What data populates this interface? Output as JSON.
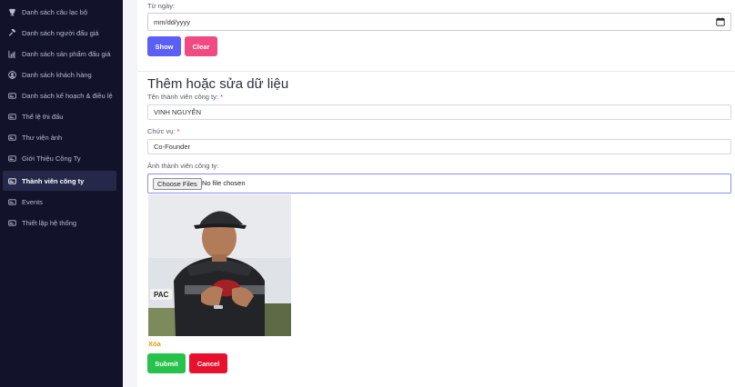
{
  "sidebar": {
    "items": [
      {
        "label": "Danh sách câu lạc bộ",
        "icon": "trophy-icon"
      },
      {
        "label": "Danh sách người đấu giá",
        "icon": "gavel-icon"
      },
      {
        "label": "Danh sách sản phẩm đấu giá",
        "icon": "chart-icon"
      },
      {
        "label": "Danh sách khách hàng",
        "icon": "user-icon"
      },
      {
        "label": "Danh sách kế hoạch & điều lệ",
        "icon": "card-icon"
      },
      {
        "label": "Thể lệ thi đấu",
        "icon": "card-icon"
      },
      {
        "label": "Thư viện ảnh",
        "icon": "card-icon"
      },
      {
        "label": "Giới Thiệu Công Ty",
        "icon": "card-icon"
      },
      {
        "label": "Thành viên công ty",
        "icon": "card-icon",
        "active": true
      },
      {
        "label": "Events",
        "icon": "card-icon"
      },
      {
        "label": "Thiết lập hệ thống",
        "icon": "card-icon"
      }
    ]
  },
  "filter": {
    "from_label": "Từ ngày:",
    "from_placeholder": "mm/dd/yyyy",
    "show_label": "Show",
    "clear_label": "Clear"
  },
  "form": {
    "title": "Thêm hoặc sửa dữ liệu",
    "name_label": "Tên thành viên công ty:",
    "name_value": "VINH NGUYỄN",
    "position_label": "Chức vụ:",
    "position_value": "Co-Founder",
    "photo_label": "Ảnh thành viên công ty:",
    "choose_files_label": "Choose Files",
    "file_status": "No file chosen",
    "delete_label": "Xóa",
    "submit_label": "Submit",
    "cancel_label": "Cancel",
    "required_mark": "*"
  },
  "colors": {
    "sidebar_bg": "#12132b",
    "show_button": "#5b5ff5",
    "clear_button": "#ef4a82",
    "submit_button": "#27c24c",
    "cancel_button": "#e8112d",
    "delete_link": "#e39b00"
  }
}
